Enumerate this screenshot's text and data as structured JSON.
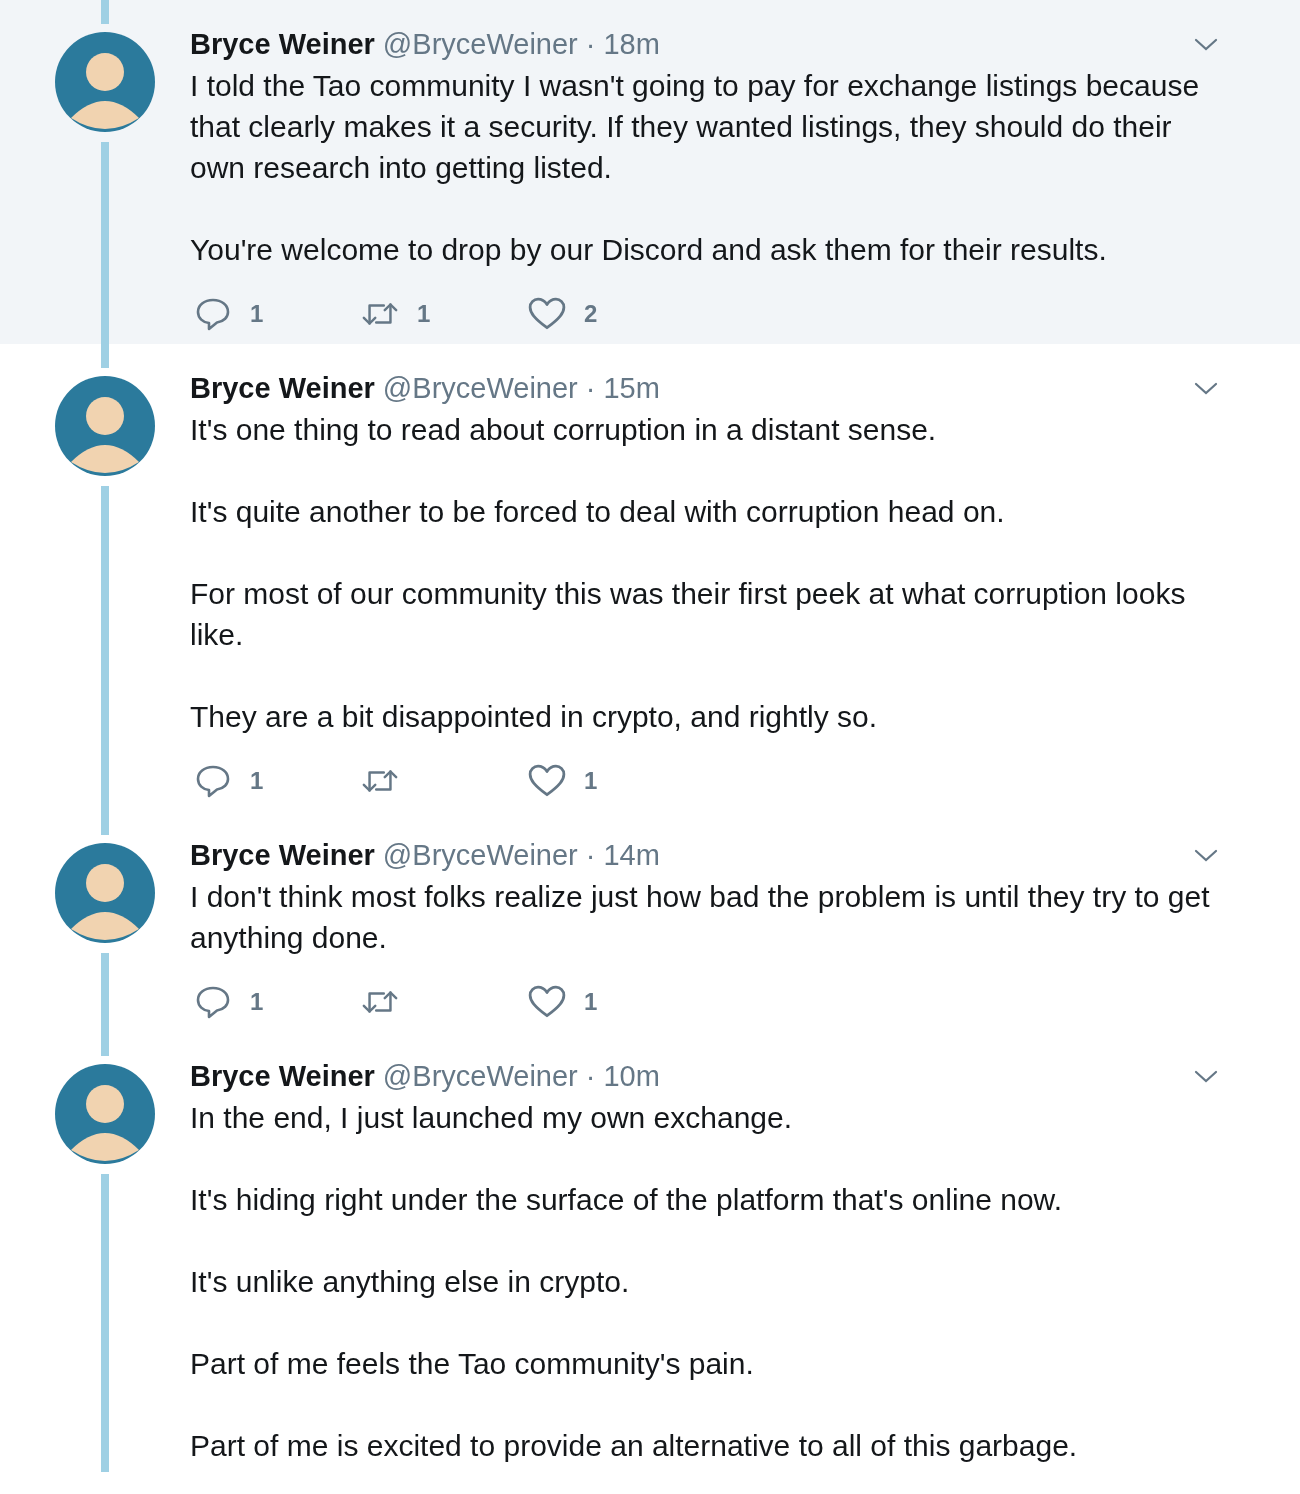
{
  "tweets": [
    {
      "highlighted": true,
      "name": "Bryce Weiner",
      "handle": "@BryceWeiner",
      "separator": "·",
      "time": "18m",
      "paragraphs": [
        "I told the Tao community I wasn't going to pay for exchange listings because that clearly makes it a security.  If they wanted listings, they should do their own research into getting listed.",
        "You're welcome to drop by our Discord and ask them for their results."
      ],
      "actions": [
        {
          "kind": "reply",
          "count": "1"
        },
        {
          "kind": "retweet",
          "count": "1"
        },
        {
          "kind": "like",
          "count": "2"
        }
      ]
    },
    {
      "highlighted": false,
      "name": "Bryce Weiner",
      "handle": "@BryceWeiner",
      "separator": "·",
      "time": "15m",
      "paragraphs": [
        "It's one thing to read about corruption in a distant sense.",
        "It's quite another to be forced to deal with corruption head on.",
        "For most of our community this was their first peek at what corruption looks like.",
        "They are a bit disappointed in crypto, and rightly so."
      ],
      "actions": [
        {
          "kind": "reply",
          "count": "1"
        },
        {
          "kind": "retweet"
        },
        {
          "kind": "like",
          "count": "1"
        }
      ]
    },
    {
      "highlighted": false,
      "name": "Bryce Weiner",
      "handle": "@BryceWeiner",
      "separator": "·",
      "time": "14m",
      "paragraphs": [
        "I don't think most folks realize just how bad the problem is until they try to get anything done."
      ],
      "actions": [
        {
          "kind": "reply",
          "count": "1"
        },
        {
          "kind": "retweet"
        },
        {
          "kind": "like",
          "count": "1"
        }
      ]
    },
    {
      "highlighted": false,
      "name": "Bryce Weiner",
      "handle": "@BryceWeiner",
      "separator": "·",
      "time": "10m",
      "paragraphs": [
        "In the end, I just launched my own exchange.",
        "It's hiding right under the surface of the platform that's online now.",
        "It's unlike anything else in crypto.",
        "Part of me feels the Tao community's pain.",
        "Part of me is excited to provide an alternative to all of this garbage."
      ]
    }
  ]
}
